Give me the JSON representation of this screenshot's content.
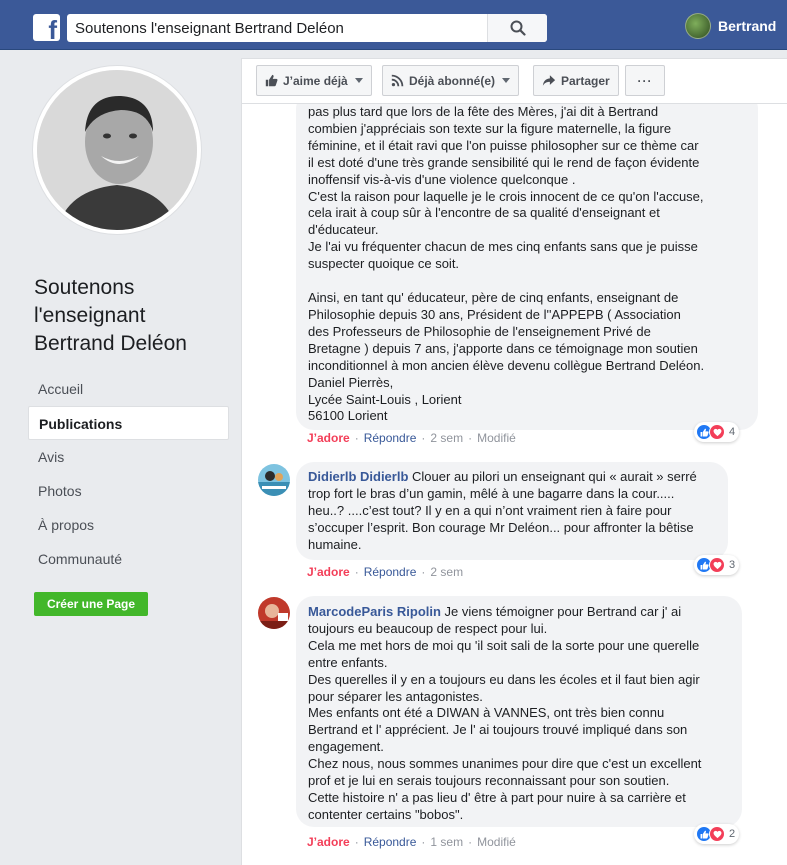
{
  "topbar": {
    "logo": "f",
    "search_value": "Soutenons l'enseignant Bertrand Deléon",
    "user_name": "Bertrand"
  },
  "page": {
    "title": "Soutenons l'enseignant Bertrand Deléon",
    "nav": [
      "Accueil",
      "Publications",
      "Avis",
      "Photos",
      "À propos",
      "Communauté"
    ],
    "active_nav": "Publications",
    "create_page": "Créer une Page"
  },
  "actions": {
    "like": "J’aime déjà",
    "follow": "Déjà abonné(e)",
    "share": "Partager",
    "more": "···"
  },
  "comments": [
    {
      "text": "pas plus tard que lors de la fête des Mères, j'ai dit à Bertrand\ncombien j'appréciais son texte sur la figure maternelle, la figure\nféminine, et il était ravi que l'on puisse philosopher sur ce thème car\nil est doté d'une très grande sensibilité qui le rend de façon évidente\ninoffensif vis-à-vis d'une violence quelconque .\nC'est la raison pour laquelle je le crois innocent de ce qu'on l'accuse,\ncela irait à coup sûr à l'encontre de sa qualité d'enseignant et\nd'éducateur.\nJe l'ai vu fréquenter chacun de mes cinq enfants sans que je puisse\nsuspecter quoique ce soit.",
      "text2": "Ainsi, en tant qu' éducateur, père de cinq enfants, enseignant de\nPhilosophie depuis 30 ans, Président de l''APPEPB ( Association\ndes Professeurs de Philosophie de l'enseignement Privé de\nBretagne ) depuis 7 ans, j'apporte dans ce témoignage mon soutien\ninconditionnel à mon ancien élève devenu collègue Bertrand Deléon.\nDaniel Pierrès,\nLycée Saint-Louis , Lorient\n56100 Lorient",
      "meta": {
        "react": "J’adore",
        "reply": "Répondre",
        "time": "2 sem",
        "edited": "Modifié"
      },
      "reactions": "4"
    },
    {
      "author": "Didierlb Didierlb",
      "text": "Clouer au pilori un enseignant qui « aurait » serré\ntrop fort le bras d’un gamin, mêlé à une bagarre dans la cour.....\nheu..? ....c’est tout? Il y en a qui n’ont vraiment rien à faire pour\ns’occuper l’esprit. Bon courage Mr Deléon... pour affronter la bêtise\nhumaine.",
      "meta": {
        "react": "J’adore",
        "reply": "Répondre",
        "time": "2 sem"
      },
      "reactions": "3"
    },
    {
      "author": "MarcodeParis Ripolin",
      "text": "Je viens témoigner pour Bertrand car j' ai\ntoujours eu beaucoup de respect pour lui.\nCela me met hors de moi qu 'il soit sali de la sorte pour une querelle\nentre enfants.\nDes querelles il y en a toujours eu dans les écoles et il faut bien agir\npour séparer les antagonistes.\nMes enfants ont été a DIWAN à VANNES, ont très bien connu\nBertrand et l' apprécient. Je l' ai toujours trouvé impliqué dans son\nengagement.\nChez nous, nous sommes unanimes pour dire que c'est un excellent\nprof et je lui en serais toujours reconnaissant pour son soutien.\nCette histoire n' a pas lieu d' être à part pour nuire à sa carrière et\ncontenter certains \"bobos\".",
      "meta": {
        "react": "J’adore",
        "reply": "Répondre",
        "time": "1 sem",
        "edited": "Modifié"
      },
      "reactions": "2"
    }
  ]
}
